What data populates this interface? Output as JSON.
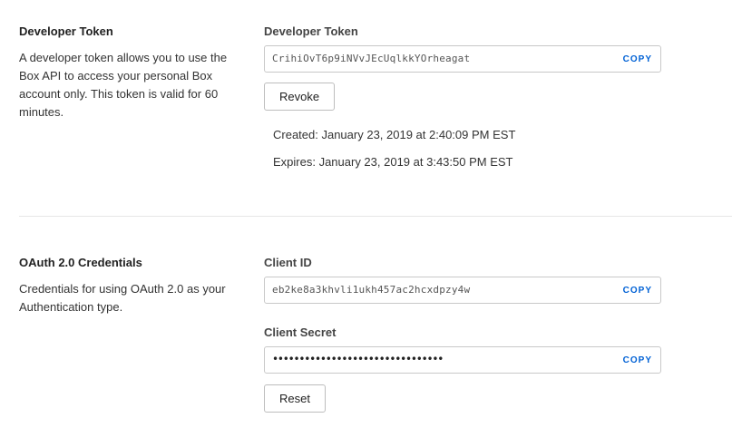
{
  "developer_token_section": {
    "title": "Developer Token",
    "description": "A developer token allows you to use the Box API to access your personal Box account only. This token is valid for 60 minutes.",
    "field_label": "Developer Token",
    "token_value": "CrihiOvT6p9iNVvJEcUqlkkYOrheagat",
    "copy_label": "COPY",
    "revoke_label": "Revoke",
    "created_text": "Created: January 23, 2019 at 2:40:09 PM EST",
    "expires_text": "Expires: January 23, 2019 at 3:43:50 PM EST"
  },
  "oauth_section": {
    "title": "OAuth 2.0 Credentials",
    "description": "Credentials for using OAuth 2.0 as your Authentication type.",
    "client_id_label": "Client ID",
    "client_id_value": "eb2ke8a3khvli1ukh457ac2hcxdpzy4w",
    "client_id_copy_label": "COPY",
    "client_secret_label": "Client Secret",
    "client_secret_value": "••••••••••••••••••••••••••••••••",
    "client_secret_copy_label": "COPY",
    "reset_label": "Reset"
  },
  "colors": {
    "accent": "#0061d5",
    "border": "#c8c8c8",
    "divider": "#e6e6e6"
  }
}
